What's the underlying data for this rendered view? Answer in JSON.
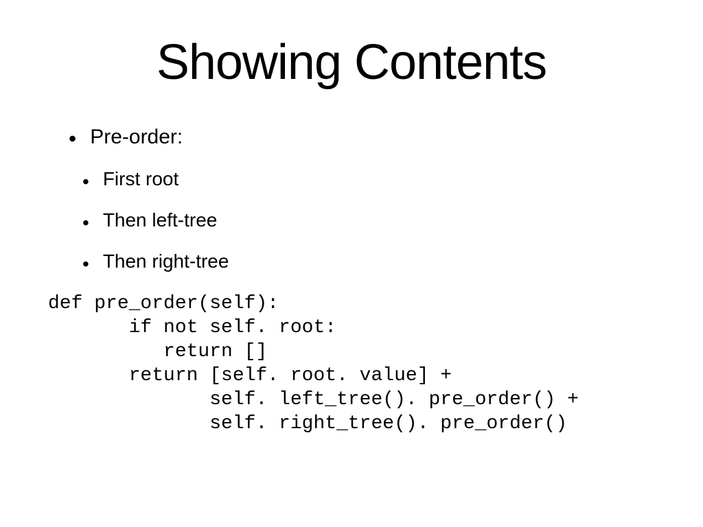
{
  "title": "Showing Contents",
  "bullets": {
    "main": "Pre-order:",
    "sub": [
      "First root",
      "Then left-tree",
      "Then right-tree"
    ]
  },
  "code": "def pre_order(self):\n       if not self. root:\n          return []\n       return [self. root. value] +\n              self. left_tree(). pre_order() +\n              self. right_tree(). pre_order()"
}
